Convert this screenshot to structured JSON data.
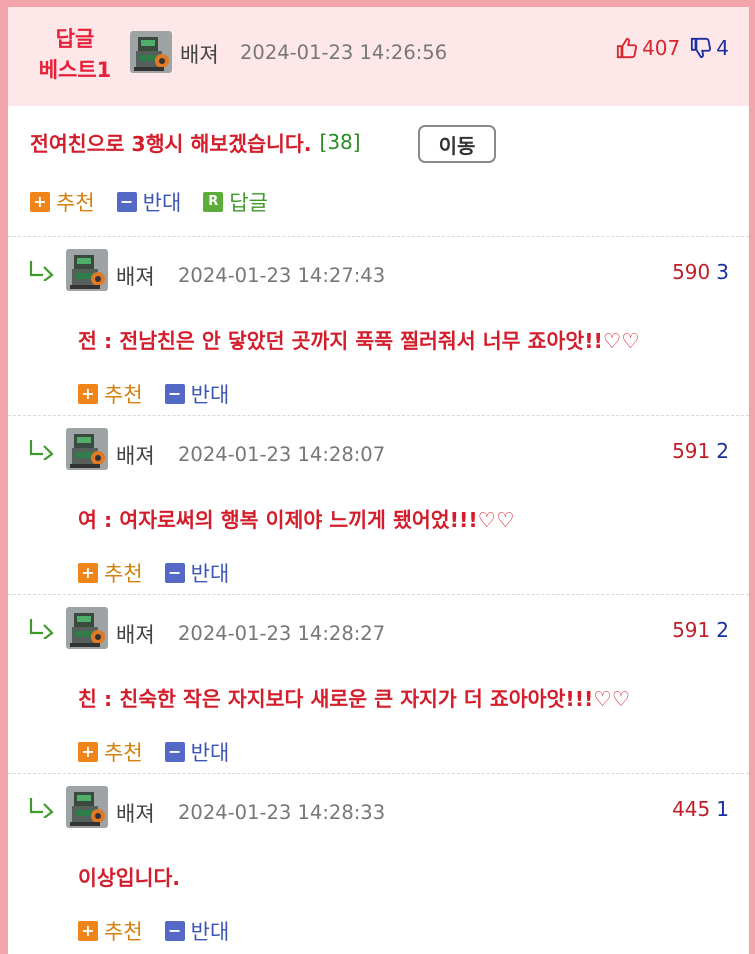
{
  "best": {
    "label_line1": "답글",
    "label_line2": "베스트1",
    "nickname": "배져",
    "datetime": "2024-01-23 14:26:56",
    "upvotes": "407",
    "downvotes": "4",
    "up_icon": "thumbs-up-icon",
    "down_icon": "thumbs-down-icon"
  },
  "parent": {
    "title": "전여친으로 3행시 해보겠습니다.",
    "reply_count": "[38]",
    "move_label": "이동",
    "actions": {
      "recommend": "추천",
      "oppose": "반대",
      "reply": "답글"
    }
  },
  "comments": [
    {
      "nickname": "배져",
      "datetime": "2024-01-23 14:27:43",
      "up": "590",
      "down": "3",
      "text": "전 : 전남친은 안 닿았던 곳까지 푹푹 찔러줘서 너무 죠아앗!!♡♡",
      "recommend": "추천",
      "oppose": "반대"
    },
    {
      "nickname": "배져",
      "datetime": "2024-01-23 14:28:07",
      "up": "591",
      "down": "2",
      "text": "여 : 여자로써의 행복 이제야 느끼게 됐어었!!!♡♡",
      "recommend": "추천",
      "oppose": "반대"
    },
    {
      "nickname": "배져",
      "datetime": "2024-01-23 14:28:27",
      "up": "591",
      "down": "2",
      "text": "친 : 친숙한 작은 자지보다 새로운 큰 자지가 더 죠아아앗!!!♡♡",
      "recommend": "추천",
      "oppose": "반대"
    },
    {
      "nickname": "배져",
      "datetime": "2024-01-23 14:28:33",
      "up": "445",
      "down": "1",
      "text": "이상입니다.",
      "recommend": "추천",
      "oppose": "반대"
    }
  ],
  "colors": {
    "frame_border": "#f4a4ab",
    "header_bg": "#fde7e9",
    "accent_red": "#d41d2a",
    "up_orange": "#ef8418",
    "down_blue": "#5469c5",
    "reply_green": "#5cac3a"
  }
}
